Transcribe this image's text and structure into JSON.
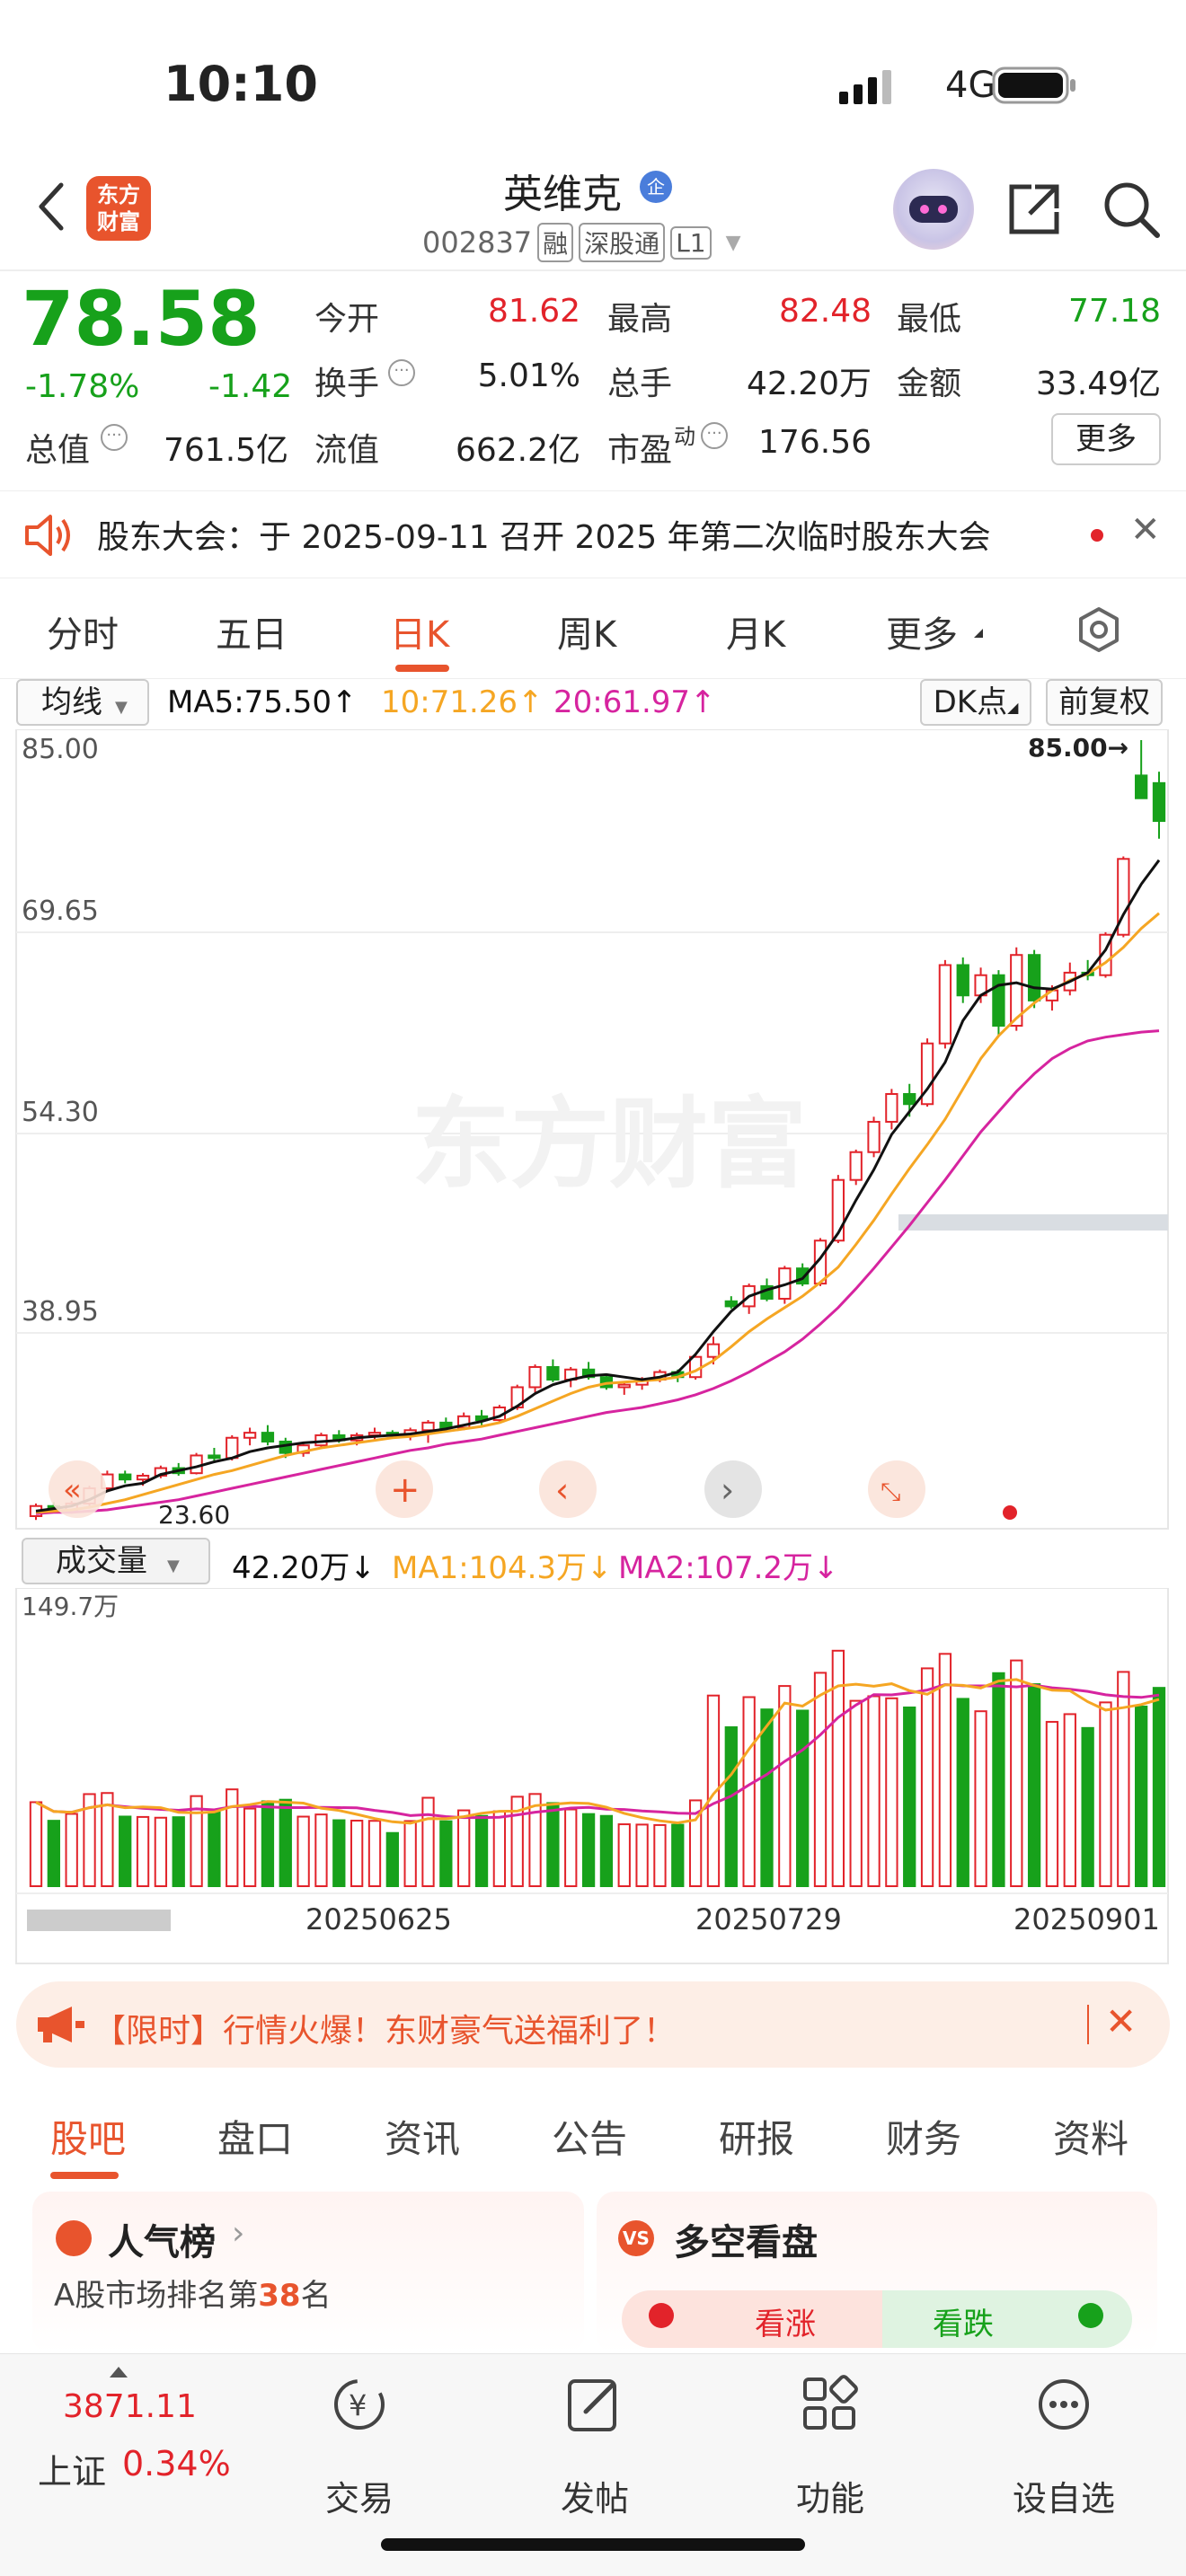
{
  "status_bar": {
    "time": "10:10",
    "network": "4G"
  },
  "header": {
    "logo_text_1": "东方",
    "logo_text_2": "财富",
    "stock_name": "英维克",
    "stock_badge": "企",
    "code": "002837",
    "tags": [
      "融",
      "深股通",
      "L1"
    ]
  },
  "quote": {
    "price": "78.58",
    "change_pct": "-1.78%",
    "change_abs": "-1.42",
    "items": [
      {
        "label": "今开",
        "value": "81.62",
        "color": "#e2232a"
      },
      {
        "label": "最高",
        "value": "82.48",
        "color": "#e2232a"
      },
      {
        "label": "最低",
        "value": "77.18",
        "color": "#17a11b"
      },
      {
        "label": "换手",
        "value": "5.01%",
        "color": "#222222"
      },
      {
        "label": "总手",
        "value": "42.20万",
        "color": "#222222"
      },
      {
        "label": "金额",
        "value": "33.49亿",
        "color": "#222222"
      },
      {
        "label": "总值",
        "value": "761.5亿",
        "color": "#222222"
      },
      {
        "label": "流值",
        "value": "662.2亿",
        "color": "#222222"
      },
      {
        "label": "市盈",
        "value": "176.56",
        "color": "#222222"
      }
    ],
    "pe_superscript": "动",
    "more_label": "更多"
  },
  "notice": {
    "text": "股东大会：于 2025-09-11 召开 2025 年第二次临时股东大会"
  },
  "period_tabs": [
    "分时",
    "五日",
    "日K",
    "周K",
    "月K",
    "更多"
  ],
  "active_period": "日K",
  "ma_row": {
    "selector": "均线",
    "ma5": "MA5:75.50",
    "ma10": "10:71.26",
    "ma20": "20:61.97",
    "dk_label": "DK点",
    "adjust_label": "前复权"
  },
  "kchart": {
    "y_labels": [
      "85.00",
      "69.65",
      "54.30",
      "38.95"
    ],
    "high_marker": "85.00→",
    "low_marker": "23.60",
    "watermark": "东方财富"
  },
  "volume": {
    "selector": "成交量",
    "current": "42.20万",
    "ma1": "MA1:104.3万",
    "ma2": "MA2:107.2万",
    "max_label": "149.7万",
    "dates": [
      "20250625",
      "20250729",
      "20250901"
    ]
  },
  "promo": {
    "text": "【限时】行情火爆！东财豪气送福利了！"
  },
  "section_tabs": [
    "股吧",
    "盘口",
    "资讯",
    "公告",
    "研报",
    "财务",
    "资料"
  ],
  "cards": {
    "left_title": "人气榜",
    "left_sub_prefix": "A股市场排名第",
    "left_rank": "38",
    "left_sub_suffix": "名",
    "right_title": "多空看盘",
    "bull": "看涨",
    "bear": "看跌"
  },
  "bottom_bar": {
    "index_value": "3871.11",
    "index_name": "上证",
    "index_change": "0.34%",
    "items": [
      "交易",
      "发帖",
      "功能",
      "设自选"
    ]
  },
  "colors": {
    "up": "#e2232a",
    "down": "#17a11b",
    "accent": "#e8542d",
    "ma5": "#111111",
    "ma10": "#f5a623",
    "ma20": "#d6249f"
  },
  "chart_data": {
    "type": "candlestick",
    "ylim": [
      23.6,
      85.0
    ],
    "candles": [
      [
        23.6,
        24.6,
        23.3,
        24.4
      ],
      [
        24.4,
        24.7,
        23.9,
        24.1
      ],
      [
        24.0,
        24.8,
        23.8,
        24.6
      ],
      [
        24.6,
        26.0,
        24.4,
        25.8
      ],
      [
        25.8,
        27.2,
        25.5,
        26.9
      ],
      [
        26.9,
        27.2,
        26.2,
        26.5
      ],
      [
        26.5,
        27.0,
        26.0,
        26.8
      ],
      [
        26.8,
        27.6,
        26.6,
        27.4
      ],
      [
        27.4,
        27.8,
        26.8,
        27.0
      ],
      [
        27.0,
        28.6,
        26.9,
        28.4
      ],
      [
        28.4,
        29.0,
        27.8,
        28.2
      ],
      [
        28.2,
        30.0,
        28.0,
        29.8
      ],
      [
        29.8,
        30.6,
        29.2,
        30.2
      ],
      [
        30.2,
        30.8,
        29.2,
        29.5
      ],
      [
        29.5,
        29.8,
        28.2,
        28.6
      ],
      [
        28.6,
        29.4,
        28.3,
        29.2
      ],
      [
        29.2,
        30.2,
        29.0,
        30.0
      ],
      [
        30.0,
        30.4,
        29.4,
        29.6
      ],
      [
        29.6,
        30.2,
        29.2,
        30.0
      ],
      [
        30.0,
        30.6,
        29.6,
        30.2
      ],
      [
        30.2,
        30.4,
        29.8,
        30.0
      ],
      [
        30.0,
        30.6,
        29.6,
        30.4
      ],
      [
        30.4,
        31.2,
        29.4,
        31.0
      ],
      [
        31.0,
        31.4,
        30.4,
        30.6
      ],
      [
        30.6,
        31.8,
        30.4,
        31.5
      ],
      [
        31.5,
        32.0,
        30.8,
        31.2
      ],
      [
        31.2,
        32.4,
        31.0,
        32.2
      ],
      [
        32.2,
        34.0,
        32.0,
        33.8
      ],
      [
        33.8,
        35.6,
        33.4,
        35.4
      ],
      [
        35.4,
        36.0,
        34.2,
        34.4
      ],
      [
        34.4,
        35.4,
        33.8,
        35.2
      ],
      [
        35.2,
        35.8,
        34.4,
        34.6
      ],
      [
        34.6,
        34.9,
        33.6,
        33.8
      ],
      [
        33.8,
        34.2,
        33.2,
        34.0
      ],
      [
        34.0,
        34.6,
        33.6,
        34.4
      ],
      [
        34.4,
        35.2,
        34.2,
        35.0
      ],
      [
        35.0,
        35.2,
        34.2,
        34.6
      ],
      [
        34.6,
        36.4,
        34.4,
        36.2
      ],
      [
        36.2,
        37.8,
        35.6,
        37.2
      ],
      [
        40.6,
        41.0,
        40.0,
        40.2
      ],
      [
        40.2,
        42.0,
        39.6,
        41.8
      ],
      [
        41.8,
        42.4,
        40.6,
        40.8
      ],
      [
        40.8,
        43.4,
        40.4,
        43.2
      ],
      [
        43.2,
        43.6,
        41.8,
        42.0
      ],
      [
        42.0,
        45.6,
        41.8,
        45.4
      ],
      [
        45.4,
        50.6,
        45.2,
        50.2
      ],
      [
        50.2,
        52.6,
        49.8,
        52.4
      ],
      [
        52.4,
        55.2,
        52.0,
        54.8
      ],
      [
        54.8,
        57.4,
        54.2,
        57.0
      ],
      [
        57.0,
        57.8,
        55.2,
        56.2
      ],
      [
        56.2,
        61.4,
        56.0,
        61.0
      ],
      [
        61.0,
        67.6,
        60.6,
        67.2
      ],
      [
        67.2,
        67.8,
        64.2,
        64.8
      ],
      [
        64.8,
        67.0,
        64.2,
        66.4
      ],
      [
        66.4,
        66.8,
        61.6,
        62.4
      ],
      [
        62.4,
        68.6,
        62.0,
        68.0
      ],
      [
        68.0,
        68.4,
        63.8,
        64.4
      ],
      [
        64.4,
        65.6,
        63.6,
        65.2
      ],
      [
        65.2,
        67.4,
        64.8,
        66.6
      ],
      [
        66.6,
        67.6,
        66.0,
        66.4
      ],
      [
        66.4,
        69.8,
        66.2,
        69.6
      ],
      [
        69.6,
        75.8,
        69.4,
        75.6
      ],
      [
        82.2,
        85.0,
        81.2,
        80.4
      ],
      [
        81.6,
        82.5,
        77.2,
        78.6
      ]
    ],
    "ma5": [
      24.0,
      24.2,
      24.4,
      24.9,
      25.6,
      26.0,
      26.2,
      26.9,
      27.2,
      27.5,
      27.9,
      28.2,
      28.7,
      29.0,
      29.2,
      29.4,
      29.5,
      29.6,
      29.8,
      29.9,
      30.0,
      30.1,
      30.3,
      30.5,
      30.8,
      31.1,
      31.5,
      32.3,
      33.3,
      34.0,
      34.4,
      34.7,
      34.8,
      34.6,
      34.4,
      34.6,
      35.0,
      36.4,
      38.2,
      39.8,
      41.0,
      41.5,
      41.9,
      42.4,
      44.0,
      46.0,
      48.6,
      51.0,
      53.8,
      55.6,
      57.4,
      59.5,
      62.8,
      64.8,
      65.6,
      65.8,
      65.4,
      65.3,
      65.9,
      66.6,
      68.4,
      71.2,
      73.6,
      75.5
    ],
    "ma10": [
      23.9,
      24.0,
      24.1,
      24.3,
      24.6,
      24.9,
      25.3,
      25.7,
      26.1,
      26.5,
      26.9,
      27.2,
      27.6,
      28.0,
      28.4,
      28.7,
      29.0,
      29.2,
      29.4,
      29.6,
      29.8,
      29.9,
      30.1,
      30.3,
      30.5,
      30.7,
      31.0,
      31.5,
      32.1,
      32.7,
      33.3,
      33.8,
      34.1,
      34.2,
      34.3,
      34.4,
      34.6,
      35.1,
      35.9,
      37.0,
      38.2,
      39.2,
      40.1,
      41.0,
      42.1,
      43.3,
      45.1,
      47.0,
      49.1,
      51.1,
      53.0,
      55.0,
      57.4,
      59.8,
      61.6,
      63.0,
      64.2,
      65.2,
      66.0,
      66.5,
      67.4,
      68.6,
      70.1,
      71.3
    ],
    "ma20": [
      23.8,
      23.9,
      23.9,
      24.0,
      24.1,
      24.3,
      24.5,
      24.7,
      24.9,
      25.2,
      25.5,
      25.8,
      26.1,
      26.4,
      26.7,
      27.0,
      27.3,
      27.6,
      27.9,
      28.2,
      28.5,
      28.8,
      29.0,
      29.3,
      29.5,
      29.7,
      30.0,
      30.3,
      30.6,
      30.9,
      31.2,
      31.5,
      31.8,
      32.0,
      32.2,
      32.5,
      32.8,
      33.2,
      33.7,
      34.3,
      35.0,
      35.8,
      36.6,
      37.6,
      38.8,
      40.1,
      41.6,
      43.2,
      44.9,
      46.6,
      48.4,
      50.2,
      52.1,
      54.0,
      55.6,
      57.2,
      58.6,
      59.8,
      60.6,
      61.2,
      61.5,
      61.7,
      61.9,
      62.0
    ]
  }
}
